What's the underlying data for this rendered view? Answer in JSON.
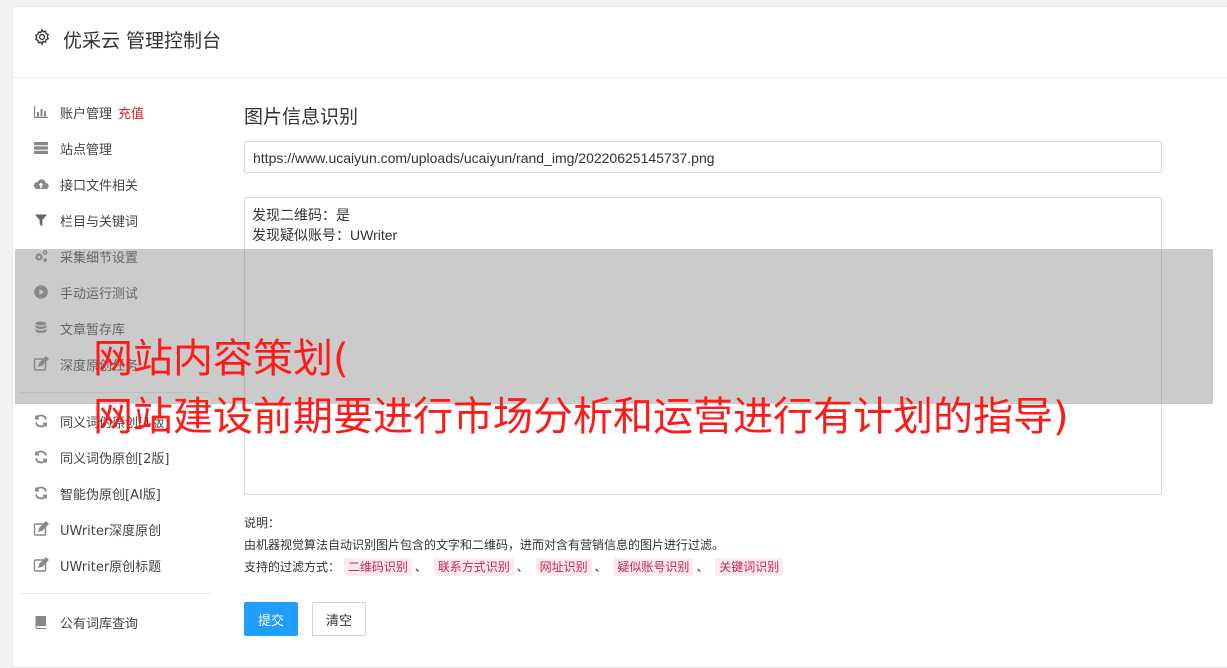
{
  "header": {
    "title": "优采云 管理控制台",
    "icon": "gear-icon"
  },
  "sidebar": {
    "items": [
      {
        "label": "账户管理",
        "accent": "充值",
        "icon": "bar-chart-icon"
      },
      {
        "label": "站点管理",
        "icon": "server-icon"
      },
      {
        "label": "接口文件相关",
        "icon": "cloud-upload-icon"
      },
      {
        "label": "栏目与关键词",
        "icon": "filter-icon"
      },
      {
        "label": "采集细节设置",
        "icon": "cogs-icon"
      },
      {
        "label": "手动运行测试",
        "icon": "play-circle-icon"
      },
      {
        "label": "文章暂存库",
        "icon": "database-icon"
      },
      {
        "label": "深度原创任务",
        "icon": "edit-icon"
      },
      {
        "label": "同义词伪原创[1版]",
        "icon": "refresh-icon"
      },
      {
        "label": "同义词伪原创[2版]",
        "icon": "refresh-icon"
      },
      {
        "label": "智能伪原创[AI版]",
        "icon": "refresh-icon"
      },
      {
        "label": "UWriter深度原创",
        "icon": "edit-icon"
      },
      {
        "label": "UWriter原创标题",
        "icon": "edit-icon"
      },
      {
        "label": "公有词库查询",
        "icon": "book-icon"
      }
    ]
  },
  "main": {
    "section_title": "图片信息识别",
    "url_value": "https://www.ucaiyun.com/uploads/ucaiyun/rand_img/20220625145737.png",
    "result_line1": "发现二维码：是",
    "result_line2": "发现疑似账号：UWriter",
    "note_title": "说明：",
    "note_desc": "由机器视觉算法自动识别图片包含的文字和二维码，进而对含有营销信息的图片进行过滤。",
    "filter_label": "支持的过滤方式：",
    "filter_tags": [
      "二维码识别",
      "联系方式识别",
      "网址识别",
      "疑似账号识别",
      "关键词识别"
    ],
    "separator": "、",
    "submit_label": "提交",
    "clear_label": "清空"
  },
  "overlay": {
    "line1": "网站内容策划(",
    "line2": "网站建设前期要进行市场分析和运营进行有计划的指导)"
  },
  "colors": {
    "accent": "#e02020",
    "primary": "#1e9fff",
    "overlay_text": "#ff1a1a",
    "tag_text": "#c7254e",
    "tag_bg": "#fcebed"
  }
}
